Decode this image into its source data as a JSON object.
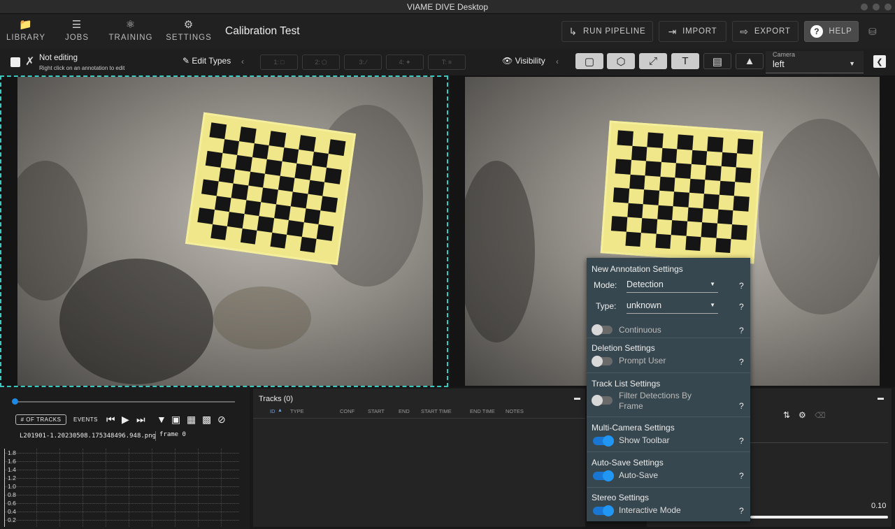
{
  "window": {
    "title": "VIAME DIVE Desktop"
  },
  "nav": {
    "library": "LIBRARY",
    "jobs": "JOBS",
    "training": "TRAINING",
    "settings": "SETTINGS"
  },
  "page_title": "Calibration Test",
  "header_buttons": {
    "run_pipeline": "RUN PIPELINE",
    "import": "IMPORT",
    "export": "EXPORT",
    "help": "HELP"
  },
  "edit_status": {
    "title": "Not editing",
    "hint": "Right click on an annotation to edit"
  },
  "edit_types": {
    "label": "Edit Types",
    "modes": [
      "1:",
      "2:",
      "3:",
      "4:",
      "T:"
    ]
  },
  "visibility": {
    "label": "Visibility"
  },
  "camera": {
    "label": "Camera",
    "value": "left"
  },
  "timeline": {
    "num_tracks_label": "# OF TRACKS",
    "events_label": "EVENTS",
    "filename": "L201901-1.20230508.175348496.948.png",
    "frame": "frame 0",
    "y_ticks": [
      "1.8",
      "1.6",
      "1.4",
      "1.2",
      "1.0",
      "0.8",
      "0.6",
      "0.4",
      "0.2"
    ]
  },
  "tracks": {
    "title": "Tracks (0)",
    "columns": [
      "ID",
      "TYPE",
      "CONF",
      "START",
      "END",
      "START TIME",
      "END TIME",
      "NOTES"
    ]
  },
  "right_panel": {
    "value": "0.10"
  },
  "popup": {
    "title": "New Annotation Settings",
    "mode_label": "Mode:",
    "mode_value": "Detection",
    "type_label": "Type:",
    "type_value": "unknown",
    "continuous": "Continuous",
    "deletion_title": "Deletion Settings",
    "prompt_user": "Prompt User",
    "tracklist_title": "Track List Settings",
    "filter_by_frame": "Filter Detections By Frame",
    "multicam_title": "Multi-Camera Settings",
    "show_toolbar": "Show Toolbar",
    "autosave_title": "Auto-Save Settings",
    "autosave": "Auto-Save",
    "stereo_title": "Stereo Settings",
    "interactive_mode": "Interactive Mode",
    "help": "?"
  }
}
